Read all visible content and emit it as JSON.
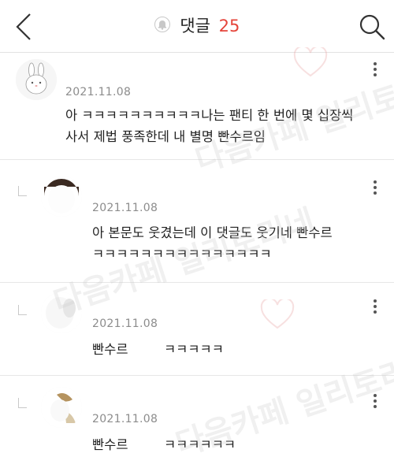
{
  "header": {
    "title": "댓글",
    "count": "25"
  },
  "watermark": "다음카페 일리토리네",
  "comments": [
    {
      "date": "2021.11.08",
      "lines": [
        "아 ㅋㅋㅋㅋㅋㅋㅋㅋㅋㅋ나는 팬티 한 번에 몇 십장씩",
        "사서 제법 풍족한데 내 별명 빤수르임"
      ]
    },
    {
      "date": "2021.11.08",
      "lines": [
        "아 본문도 웃겼는데 이 댓글도 웃기네 빤수르",
        "ㅋㅋㅋㅋㅋㅋㅋㅋㅋㅋㅋㅋㅋㅋㅋ"
      ]
    },
    {
      "date": "2021.11.08",
      "text_a": "빤수르",
      "text_b": "ㅋㅋㅋㅋㅋ"
    },
    {
      "date": "2021.11.08",
      "text_a": "빤수르",
      "text_b": "ㅋㅋㅋㅋㅋㅋ"
    }
  ]
}
